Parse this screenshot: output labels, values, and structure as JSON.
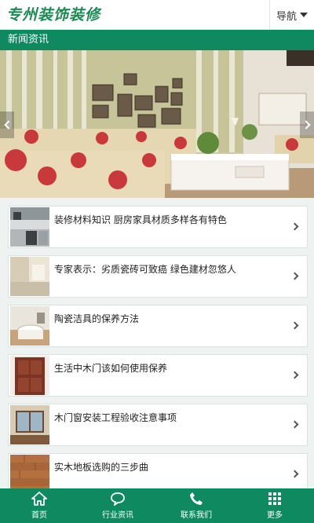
{
  "header": {
    "logo_text": "专州装饰装修",
    "nav_label": "导航"
  },
  "section": {
    "title": "新闻资讯"
  },
  "news": {
    "items": [
      {
        "title": "装修材料知识  厨房家具材质多样各有特色",
        "thumb": "kitchen"
      },
      {
        "title": "专家表示：劣质瓷砖可致癌  绿色建材忽悠人",
        "thumb": "tile-room"
      },
      {
        "title": "陶瓷洁具的保养方法",
        "thumb": "bathroom"
      },
      {
        "title": "生活中木门该如何使用保养",
        "thumb": "wood-door"
      },
      {
        "title": "木门窗安装工程验收注意事项",
        "thumb": "window-room"
      },
      {
        "title": "实木地板选购的三步曲",
        "thumb": "wood-floor"
      }
    ]
  },
  "bottom_nav": {
    "home": "首页",
    "news": "行业资讯",
    "contact": "联系我们",
    "more": "更多"
  },
  "colors": {
    "brand_green": "#0f8a60",
    "logo_green": "#1c8a55"
  }
}
